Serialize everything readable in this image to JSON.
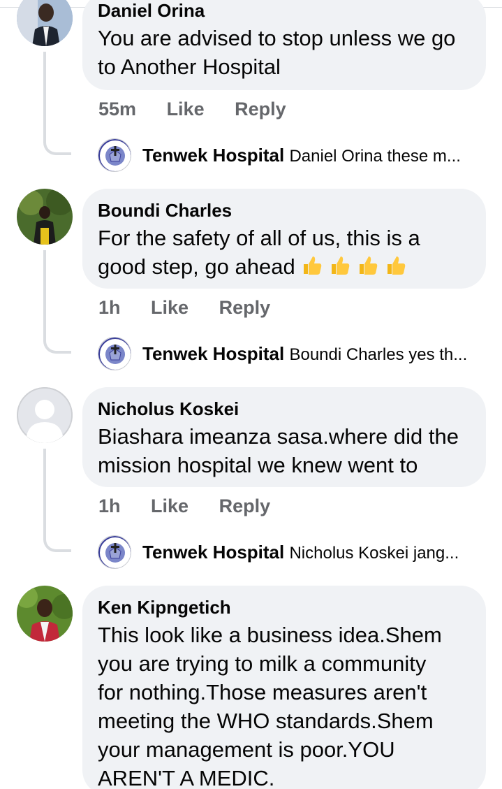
{
  "comments": [
    {
      "author": "Daniel Orina",
      "text": "You are advised to stop unless we go to Another Hospital",
      "time": "55m",
      "like": "Like",
      "reply": "Reply",
      "reply_preview": {
        "author": "Tenwek Hospital",
        "text": "Daniel Orina these m..."
      }
    },
    {
      "author": "Boundi Charles",
      "text": "For the safety of all of us, this is a good step, go ahead",
      "emoji": [
        "thumbs-up-icon",
        "thumbs-up-icon",
        "thumbs-up-icon",
        "thumbs-up-icon"
      ],
      "time": "1h",
      "like": "Like",
      "reply": "Reply",
      "reply_preview": {
        "author": "Tenwek Hospital",
        "text": "Boundi Charles yes th..."
      }
    },
    {
      "author": "Nicholus Koskei",
      "text": "Biashara imeanza sasa.where did the mission hospital we knew went to",
      "time": "1h",
      "like": "Like",
      "reply": "Reply",
      "reply_preview": {
        "author": "Tenwek Hospital",
        "text": "Nicholus Koskei jang..."
      }
    },
    {
      "author": "Ken Kipngetich",
      "text": "This look like a business idea.Shem you are trying to milk a community for nothing.Those measures aren't meeting the WHO standards.Shem your management is poor.YOU AREN'T A MEDIC."
    }
  ],
  "colors": {
    "bubble": "#f0f2f5",
    "meta_text": "#65676b",
    "thread_line": "#dadde1",
    "text": "#050505"
  }
}
